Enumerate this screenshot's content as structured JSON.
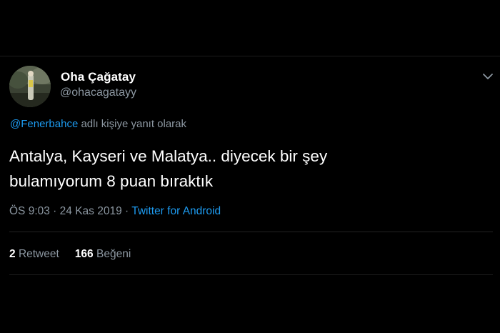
{
  "tweet": {
    "author": {
      "display_name": "Oha Çağatay",
      "handle": "@ohacagatayy"
    },
    "reply_to": {
      "mention": "@Fenerbahce",
      "suffix": " adlı kişiye yanıt olarak"
    },
    "text_line1": "Antalya, Kayseri ve Malatya.. diyecek bir şey",
    "text_line2": "bulamıyorum 8 puan bıraktık",
    "time": "ÖS 9:03",
    "separator": " · ",
    "date": "24 Kas 2019",
    "source": "Twitter for Android",
    "retweets": {
      "count": "2",
      "label": "Retweet"
    },
    "likes": {
      "count": "166",
      "label": "Beğeni"
    }
  },
  "icons": {
    "more_menu": "chevron-down-icon",
    "avatar": "profile-photo"
  },
  "colors": {
    "background": "#000000",
    "text": "#ffffff",
    "secondary": "#8c97a1",
    "accent": "#1d9bf0"
  }
}
